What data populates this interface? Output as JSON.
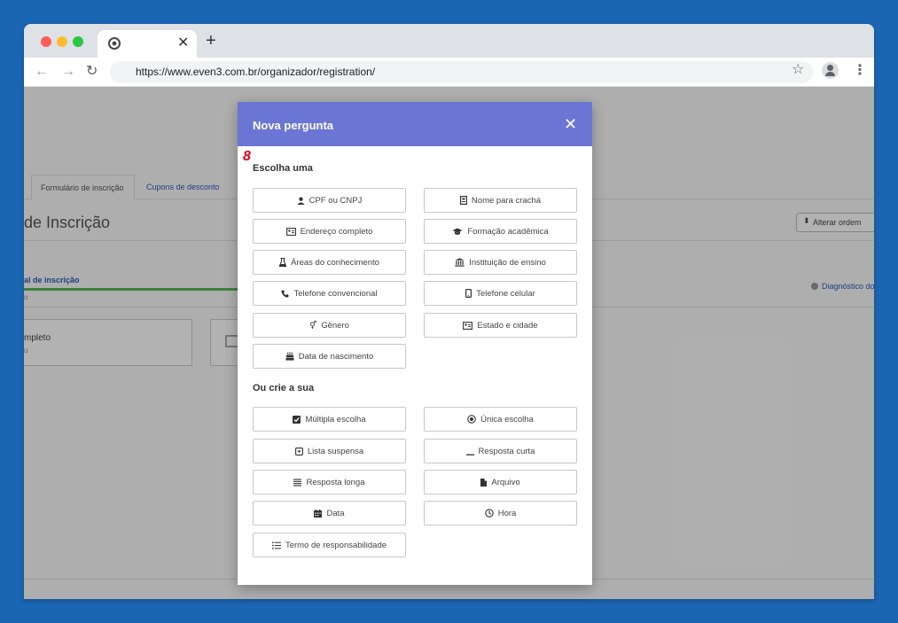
{
  "browser": {
    "url": "https://www.even3.com.br/organizador/registration/",
    "tab_close": "✕",
    "new_tab": "+"
  },
  "background_page": {
    "tabs": [
      {
        "label": "Formulário de inscrição"
      },
      {
        "label": "Cupons de desconto"
      }
    ],
    "heading": "de Inscrição",
    "reorder_label": "Alterar ordem",
    "step_active": "al de inscrição",
    "step_sub": "o",
    "step_diag": "Diagnóstico do",
    "field_card_title": "mpleto",
    "field_card_sub": "u"
  },
  "modal": {
    "title": "Nova pergunta",
    "close": "✕",
    "step_badge": "8",
    "section_choose": "Escolha uma",
    "section_create": "Ou crie a sua",
    "choose_options": [
      {
        "label": "CPF ou CNPJ",
        "icon": "user-icon"
      },
      {
        "label": "Nome para crachá",
        "icon": "badge-icon"
      },
      {
        "label": "Endereço completo",
        "icon": "address-card-icon"
      },
      {
        "label": "Formação acadêmica",
        "icon": "graduation-cap-icon"
      },
      {
        "label": "Áreas do conhecimento",
        "icon": "flask-icon"
      },
      {
        "label": "Instituição de ensino",
        "icon": "institution-icon"
      },
      {
        "label": "Telefone convencional",
        "icon": "phone-icon"
      },
      {
        "label": "Telefone celular",
        "icon": "mobile-icon"
      },
      {
        "label": "Gênero",
        "icon": "gender-icon"
      },
      {
        "label": "Estado e cidade",
        "icon": "address-card-icon"
      },
      {
        "label": "Data de nascimento",
        "icon": "birthday-cake-icon"
      }
    ],
    "create_options": [
      {
        "label": "Múltipla escolha",
        "icon": "checkbox-icon"
      },
      {
        "label": "Única escolha",
        "icon": "radio-icon"
      },
      {
        "label": "Lista suspensa",
        "icon": "dropdown-icon"
      },
      {
        "label": "Resposta curta",
        "icon": "short-line-icon"
      },
      {
        "label": "Resposta longa",
        "icon": "paragraph-icon"
      },
      {
        "label": "Arquivo",
        "icon": "file-icon"
      },
      {
        "label": "Data",
        "icon": "calendar-icon"
      },
      {
        "label": "Hora",
        "icon": "clock-icon"
      },
      {
        "label": "Termo de responsabilidade",
        "icon": "list-icon"
      }
    ]
  },
  "colors": {
    "desktop": "#1a66b3",
    "modal_header": "#6a75d4",
    "accent_blue": "#2a5cb8",
    "progress_green": "#5cb85c",
    "badge_red": "#e0001b"
  }
}
